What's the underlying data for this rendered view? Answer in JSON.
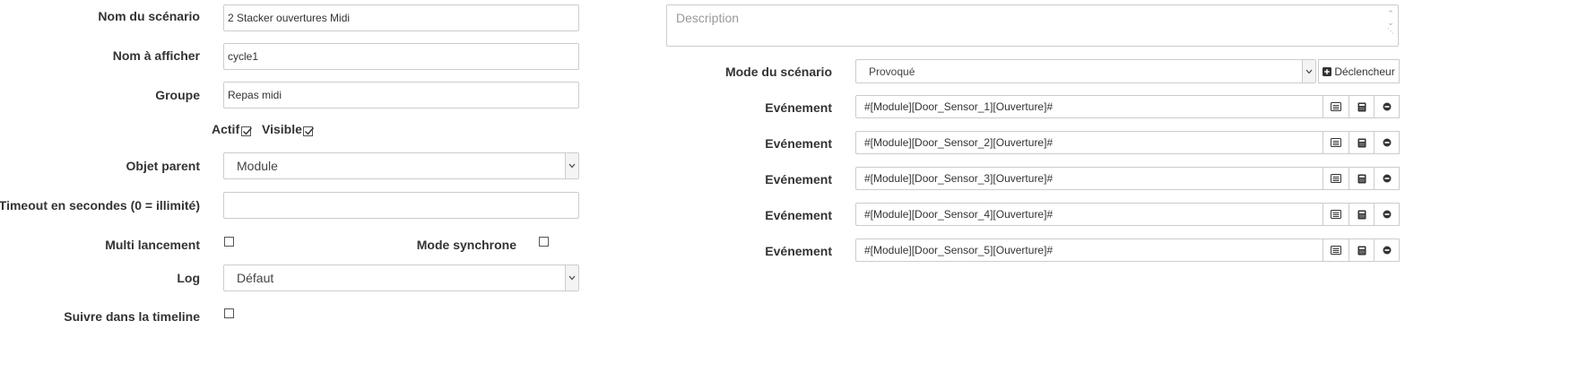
{
  "left": {
    "scenario_name_label": "Nom du scénario",
    "scenario_name_value": "2 Stacker ouvertures Midi",
    "display_name_label": "Nom à afficher",
    "display_name_value": "cycle1",
    "group_label": "Groupe",
    "group_value": "Repas midi",
    "active_label": "Actif",
    "visible_label": "Visible",
    "parent_label": "Objet parent",
    "parent_value": "Module",
    "timeout_label": "Timeout en secondes (0 = illimité)",
    "timeout_value": "",
    "multi_launch_label": "Multi lancement",
    "sync_mode_label": "Mode synchrone",
    "log_label": "Log",
    "log_value": "Défaut",
    "timeline_label": "Suivre dans la timeline"
  },
  "right": {
    "description_placeholder": "Description",
    "mode_label": "Mode du scénario",
    "mode_value": "Provoqué",
    "trigger_button_label": "Déclencheur",
    "event_label": "Evénement",
    "events": [
      "#[Module][Door_Sensor_1][Ouverture]#",
      "#[Module][Door_Sensor_2][Ouverture]#",
      "#[Module][Door_Sensor_3][Ouverture]#",
      "#[Module][Door_Sensor_4][Ouverture]#",
      "#[Module][Door_Sensor_5][Ouverture]#"
    ]
  },
  "states": {
    "active_checked": true,
    "visible_checked": true,
    "multi_launch_checked": false,
    "sync_mode_checked": false,
    "timeline_checked": false
  },
  "icons": [
    "chevron-down-icon",
    "plus-square-icon",
    "list-icon",
    "calculator-icon",
    "minus-circle-icon",
    "checkmark-icon"
  ],
  "colors": {
    "border": "#cccccc",
    "text": "#333333",
    "placeholder": "#999999"
  }
}
